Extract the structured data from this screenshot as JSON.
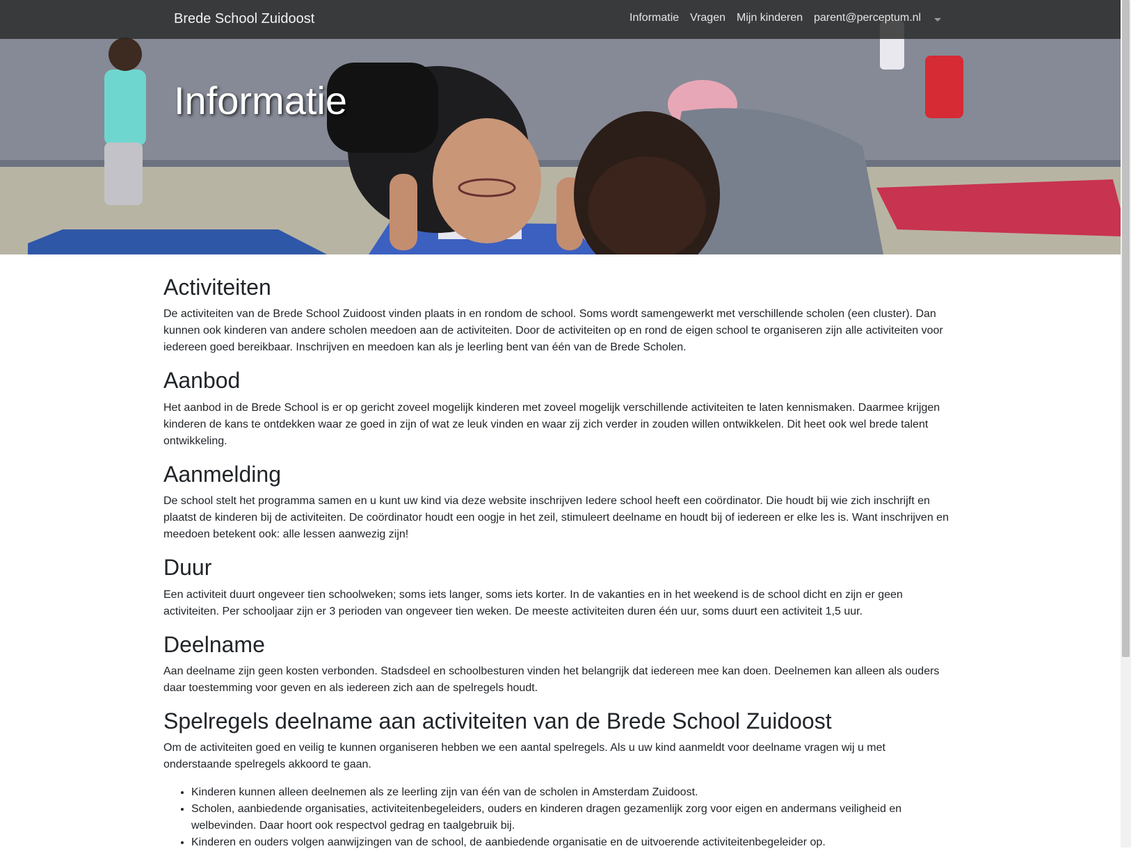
{
  "navbar": {
    "brand": "Brede School Zuidoost",
    "items": [
      {
        "label": "Informatie"
      },
      {
        "label": "Vragen"
      },
      {
        "label": "Mijn kinderen"
      },
      {
        "label": "parent@perceptum.nl"
      }
    ],
    "dropdown_icon": "caret-down-icon"
  },
  "hero": {
    "title": "Informatie",
    "image": "children-exercising-in-gym-photo"
  },
  "content": {
    "sections": [
      {
        "heading": "Activiteiten",
        "text": "De activiteiten van de Brede School Zuidoost vinden plaats in en rondom de school. Soms wordt samengewerkt met verschillende scholen (een cluster). Dan kunnen ook kinderen van andere scholen meedoen aan de activiteiten. Door de activiteiten op en rond de eigen school te organiseren zijn alle activiteiten voor iedereen goed bereikbaar. Inschrijven en meedoen kan als je leerling bent van één van de Brede Scholen."
      },
      {
        "heading": "Aanbod",
        "text": "Het aanbod in de Brede School is er op gericht zoveel mogelijk kinderen met zoveel mogelijk verschillende activiteiten te laten kennismaken. Daarmee krijgen kinderen de kans te ontdekken waar ze goed in zijn of wat ze leuk vinden en waar zij zich verder in zouden willen ontwikkelen. Dit heet ook wel brede talent ontwikkeling."
      },
      {
        "heading": "Aanmelding",
        "text": "De school stelt het programma samen en u kunt uw kind via deze website inschrijven Iedere school heeft een coördinator. Die houdt bij wie zich inschrijft en plaatst de kinderen bij de activiteiten. De coördinator houdt een oogje in het zeil, stimuleert deelname en houdt bij of iedereen er elke les is. Want inschrijven en meedoen betekent ook: alle lessen aanwezig zijn!"
      },
      {
        "heading": "Duur",
        "text": "Een activiteit duurt ongeveer tien schoolweken; soms iets langer, soms iets korter. In de vakanties en in het weekend is de school dicht en zijn er geen activiteiten. Per schooljaar zijn er 3 perioden van ongeveer tien weken. De meeste activiteiten duren één uur, soms duurt een activiteit 1,5 uur."
      },
      {
        "heading": "Deelname",
        "text": "Aan deelname zijn geen kosten verbonden. Stadsdeel en schoolbesturen vinden het belangrijk dat iedereen mee kan doen. Deelnemen kan alleen als ouders daar toestemming voor geven en als iedereen zich aan de spelregels houdt."
      },
      {
        "heading": "Spelregels deelname aan activiteiten van de Brede School Zuidoost",
        "text": "Om de activiteiten goed en veilig te kunnen organiseren hebben we een aantal spelregels. Als u uw kind aanmeldt voor deelname vragen wij u met onderstaande spelregels akkoord te gaan."
      }
    ],
    "rules": [
      "Kinderen kunnen alleen deelnemen als ze leerling zijn van één van de scholen in Amsterdam Zuidoost.",
      "Scholen, aanbiedende organisaties, activiteitenbegeleiders, ouders en kinderen dragen gezamenlijk zorg voor eigen en andermans veiligheid en welbevinden. Daar hoort ook respectvol gedrag en taalgebruik bij.",
      "Kinderen en ouders volgen aanwijzingen van de school, de aanbiedende organisatie en de uitvoerende activiteitenbegeleider op."
    ]
  }
}
